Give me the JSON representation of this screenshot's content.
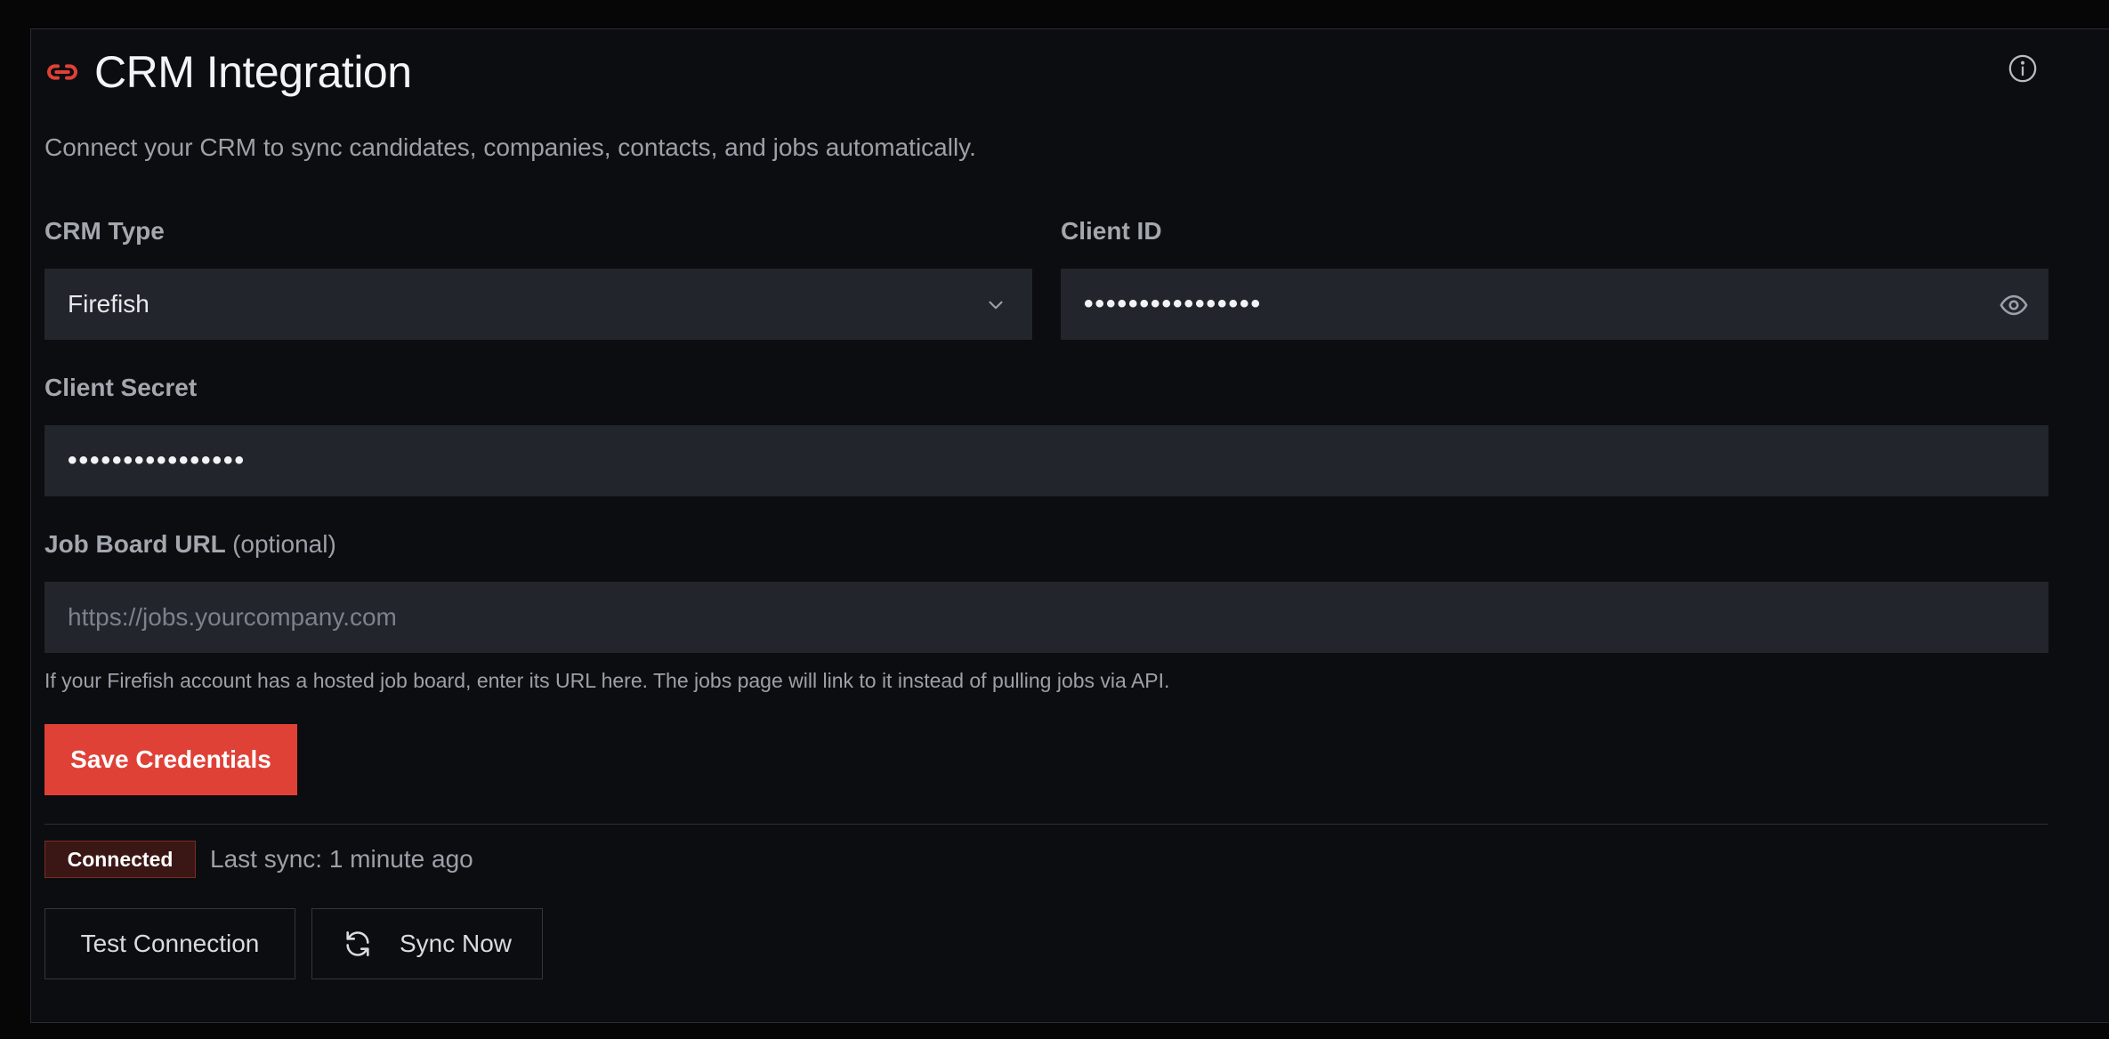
{
  "header": {
    "title": "CRM Integration",
    "icon": "link-icon",
    "accent_color": "#df4137",
    "info_icon": "info-icon"
  },
  "subtitle": "Connect your CRM to sync candidates, companies, contacts, and jobs automatically.",
  "form": {
    "crm_type": {
      "label": "CRM Type",
      "value": "Firefish"
    },
    "client_id": {
      "label": "Client ID",
      "value": "••••••••••••••••"
    },
    "client_secret": {
      "label": "Client Secret",
      "value": "••••••••••••••••"
    },
    "job_board_url": {
      "label": "Job Board URL",
      "optional": "(optional)",
      "placeholder": "https://jobs.yourcompany.com",
      "hint": "If your Firefish account has a hosted job board, enter its URL here. The jobs page will link to it instead of pulling jobs via API."
    },
    "save_label": "Save Credentials"
  },
  "status": {
    "badge": "Connected",
    "last_sync": "Last sync: 1 minute ago"
  },
  "actions": {
    "test_label": "Test Connection",
    "sync_label": "Sync Now"
  }
}
